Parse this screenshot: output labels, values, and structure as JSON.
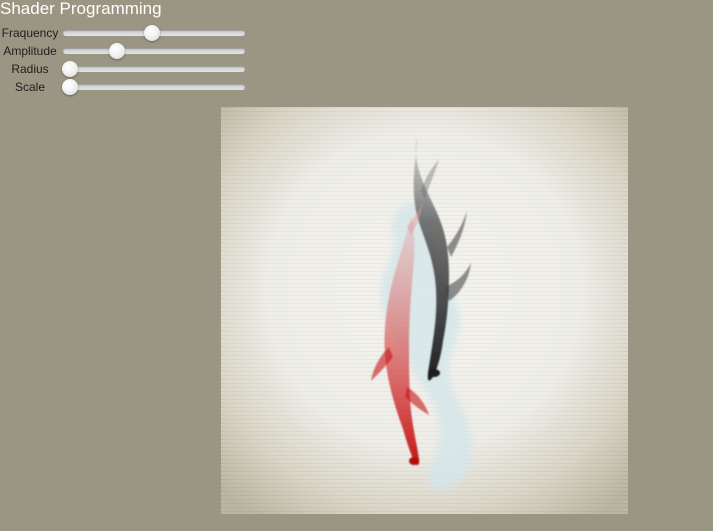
{
  "app": {
    "title": "Shader Programming"
  },
  "controls": [
    {
      "label": "Fraquency",
      "value": 0.49,
      "name": "frequency-slider"
    },
    {
      "label": "Amplitude",
      "value": 0.28,
      "name": "amplitude-slider"
    },
    {
      "label": "Radius",
      "value": 0.0,
      "name": "radius-slider"
    },
    {
      "label": "Scale",
      "value": 0.0,
      "name": "scale-slider"
    }
  ],
  "colors": {
    "background": "#9b9683",
    "title": "#ffffff",
    "paper": "#eeede7",
    "vignette": "#b9b49f",
    "water": "#d8e7ea",
    "black_fish": "#2b2b2b",
    "red_fish": "#cc1b1b"
  }
}
